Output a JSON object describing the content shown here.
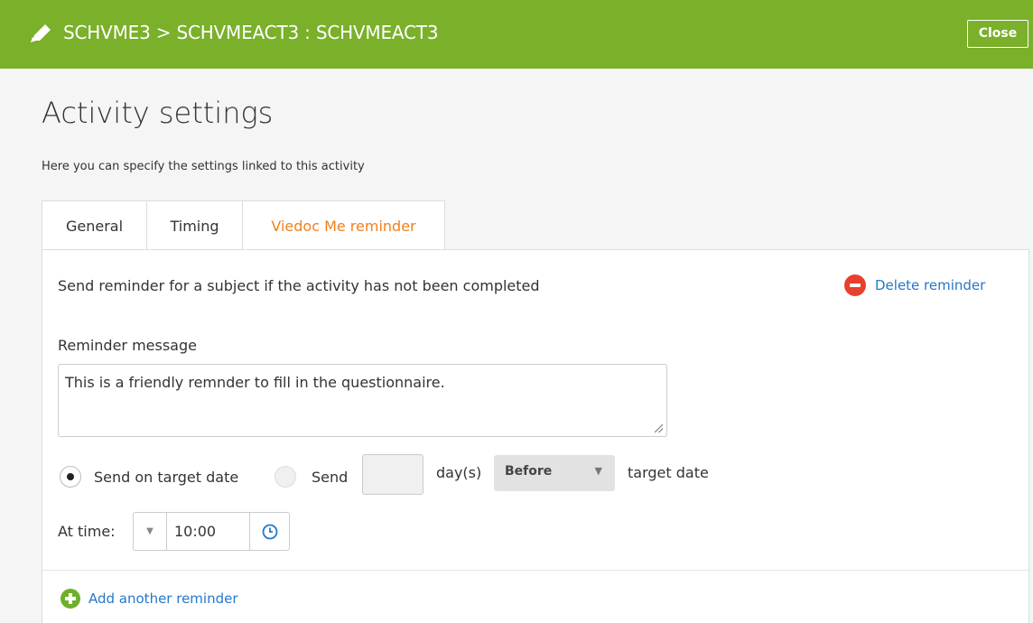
{
  "header": {
    "breadcrumb": "SCHVME3 > SCHVMEACT3 : SCHVMEACT3",
    "close_label": "Close",
    "icon": "pencil-icon",
    "color": "#7ab02a"
  },
  "page": {
    "title": "Activity settings",
    "description": "Here you can specify the settings linked to this activity"
  },
  "tabs": [
    {
      "label": "General",
      "active": false
    },
    {
      "label": "Timing",
      "active": false
    },
    {
      "label": "Viedoc Me reminder",
      "active": true
    }
  ],
  "reminder": {
    "description": "Send reminder for a subject if the activity has not been completed",
    "delete_label": "Delete reminder",
    "message_label": "Reminder message",
    "message_value": "This is a friendly remnder to fill in the questionnaire.",
    "option_target_label": "Send on target date",
    "option_target_selected": true,
    "option_send_label": "Send",
    "days_value": "",
    "days_label": "day(s)",
    "relation_selected": "Before",
    "target_date_label": "target date",
    "at_time_label": "At time:",
    "time_value": "10:00"
  },
  "footer": {
    "add_label": "Add another reminder"
  },
  "colors": {
    "accent_orange": "#f0801e",
    "link_blue": "#2678c8",
    "delete_red": "#e8402e",
    "add_green": "#6fb02a"
  }
}
